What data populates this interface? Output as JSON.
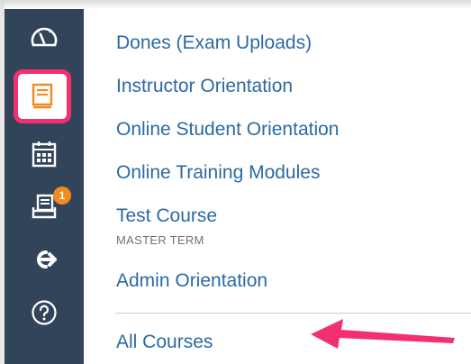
{
  "sidebar": {
    "items": [
      {
        "icon": "dashboard-icon"
      },
      {
        "icon": "courses-icon",
        "active": true
      },
      {
        "icon": "calendar-icon"
      },
      {
        "icon": "inbox-icon",
        "badge": "1"
      },
      {
        "icon": "commons-icon"
      },
      {
        "icon": "help-icon"
      }
    ],
    "highlight_color": "#f2306f",
    "background_color": "#32445a",
    "badge_color": "#f38a1e"
  },
  "courses": {
    "items": [
      {
        "label": "Dones (Exam Uploads)"
      },
      {
        "label": "Instructor Orientation"
      },
      {
        "label": "Online Student Orientation"
      },
      {
        "label": "Online Training Modules"
      },
      {
        "label": "Test Course",
        "term": "MASTER TERM"
      },
      {
        "label": "Admin Orientation"
      }
    ],
    "all_courses_label": "All Courses",
    "link_color": "#2b6aa3"
  },
  "annotation": {
    "arrow_color": "#f2306f"
  }
}
